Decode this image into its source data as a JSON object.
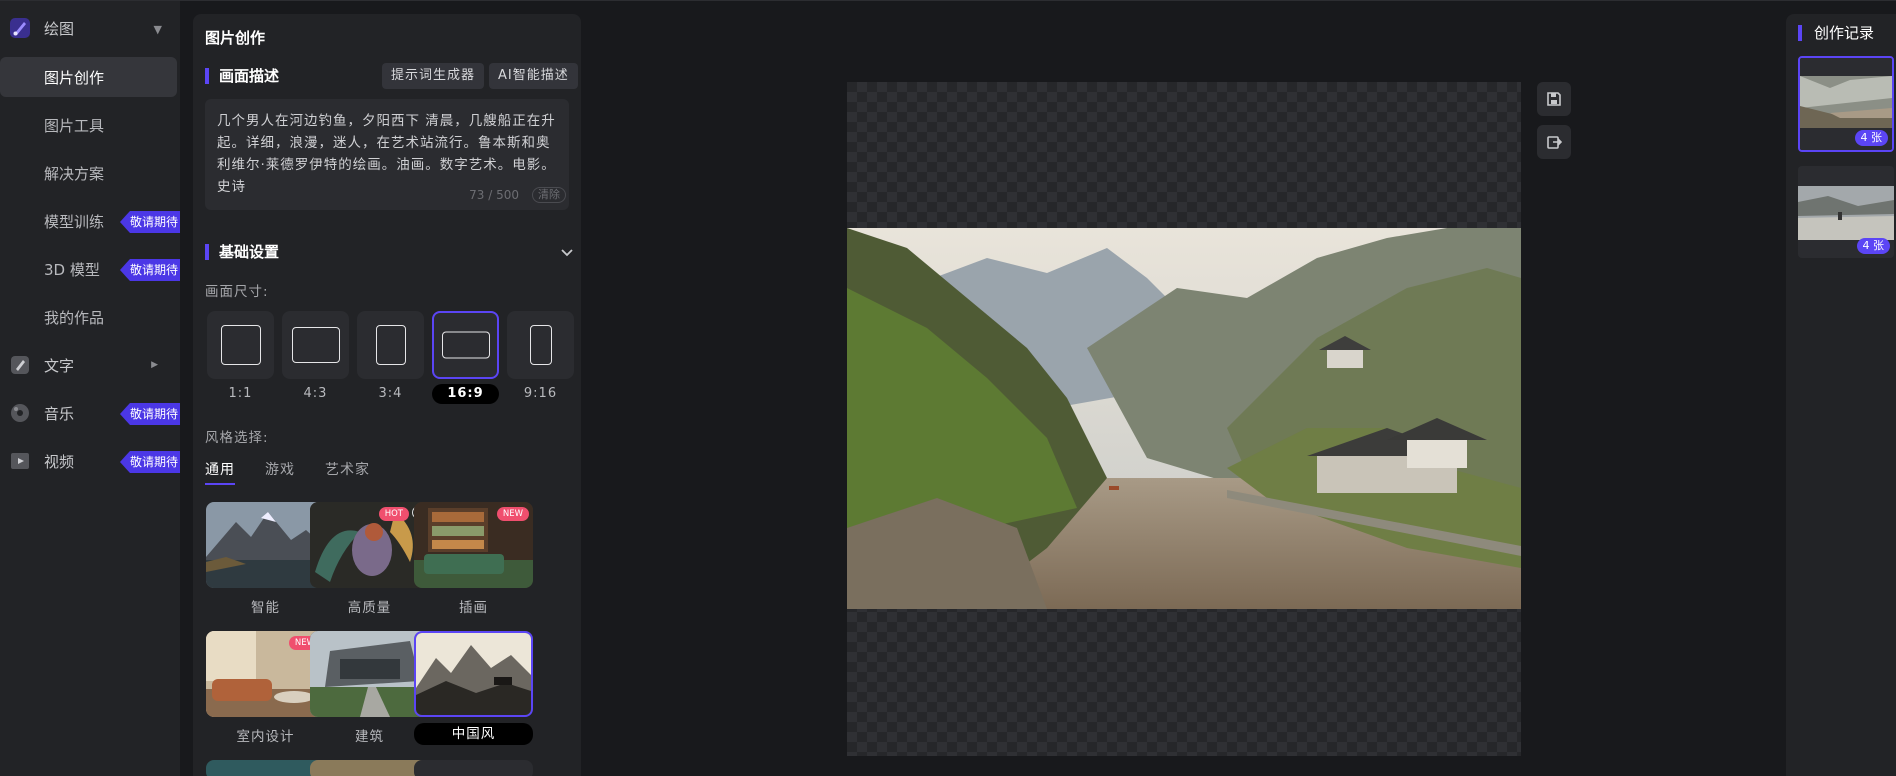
{
  "nav": {
    "header": {
      "title": "绘图",
      "icon": "brush-icon"
    },
    "items": [
      {
        "label": "图片创作",
        "active": true
      },
      {
        "label": "图片工具"
      },
      {
        "label": "解决方案"
      },
      {
        "label": "模型训练",
        "badge": "敬请期待"
      },
      {
        "label": "3D 模型",
        "badge": "敬请期待"
      },
      {
        "label": "我的作品"
      }
    ],
    "sections": [
      {
        "label": "文字",
        "icon": "pen-icon"
      },
      {
        "label": "音乐",
        "icon": "music-icon",
        "badge": "敬请期待"
      },
      {
        "label": "视频",
        "icon": "video-icon",
        "badge": "敬请期待"
      }
    ]
  },
  "panel": {
    "title": "图片创作",
    "description": {
      "title": "画面描述",
      "buttons": [
        "提示词生成器",
        "AI智能描述"
      ],
      "text": "几个男人在河边钓鱼，夕阳西下 清晨，几艘船正在升起。详细，浪漫，迷人，在艺术站流行。鲁本斯和奥利维尔·莱德罗伊特的绘画。油画。数字艺术。电影。史诗",
      "count": "73 / 500",
      "clear": "清除"
    },
    "basic": {
      "title": "基础设置",
      "size_label": "画面尺寸:",
      "ratios": [
        "1:1",
        "4:3",
        "3:4",
        "16:9",
        "9:16"
      ],
      "selected_ratio": "16:9",
      "style_label": "风格选择:",
      "tabs": [
        "通用",
        "游戏",
        "艺术家"
      ],
      "styles": [
        {
          "label": "智能"
        },
        {
          "label": "高质量",
          "tag": "HOT"
        },
        {
          "label": "插画",
          "tag": "NEW"
        },
        {
          "label": "室内设计",
          "tag": "NEW"
        },
        {
          "label": "建筑"
        },
        {
          "label": "中国风",
          "selected": true
        }
      ]
    }
  },
  "canvas": {
    "tools": [
      "save-icon",
      "export-icon"
    ]
  },
  "history": {
    "title": "创作记录",
    "items": [
      {
        "count": "4 张"
      },
      {
        "count": "4 张"
      }
    ]
  },
  "colors": {
    "accent": "#5b45f5",
    "badge": "#4b37e6",
    "bg": "#18191c",
    "panel": "#222326"
  }
}
